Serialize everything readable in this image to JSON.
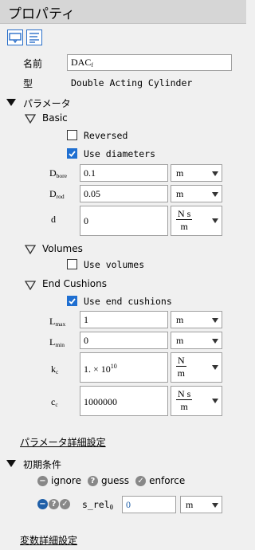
{
  "panel": {
    "title": "プロパティ"
  },
  "props": {
    "name_label": "名前",
    "name_value": "DAC",
    "name_sub": "f",
    "type_label": "型",
    "type_value": "Double Acting Cylinder"
  },
  "params": {
    "header": "パラメータ",
    "basic": {
      "header": "Basic",
      "reversed_label": "Reversed",
      "reversed_checked": false,
      "use_diameters_label": "Use diameters",
      "use_diameters_checked": true,
      "dbore": {
        "sym": "D",
        "sub": "bore",
        "value": "0.1",
        "unit": "m"
      },
      "drod": {
        "sym": "D",
        "sub": "rod",
        "value": "0.05",
        "unit": "m"
      },
      "d": {
        "sym": "d",
        "value": "0",
        "unit_num": "N s",
        "unit_den": "m"
      }
    },
    "volumes": {
      "header": "Volumes",
      "use_volumes_label": "Use volumes",
      "use_volumes_checked": false
    },
    "end_cushions": {
      "header": "End Cushions",
      "use_label": "Use end cushions",
      "use_checked": true,
      "lmax": {
        "sym": "L",
        "sub": "max",
        "value": "1",
        "unit": "m"
      },
      "lmin": {
        "sym": "L",
        "sub": "min",
        "value": "0",
        "unit": "m"
      },
      "kc": {
        "sym": "k",
        "sub": "c",
        "value_mantissa": "1. × 10",
        "value_exp": "10",
        "unit_num": "N",
        "unit_den": "m"
      },
      "cc": {
        "sym": "c",
        "sub": "c",
        "value": "1000000",
        "unit_num": "N s",
        "unit_den": "m"
      }
    },
    "details_link": "パラメータ詳細設定"
  },
  "initial": {
    "header": "初期条件",
    "legend_ignore": "ignore",
    "legend_guess": "guess",
    "legend_enforce": "enforce",
    "srel": {
      "sym": "s_rel",
      "sub": "0",
      "value": "0",
      "unit": "m"
    },
    "details_link": "変数詳細設定"
  }
}
